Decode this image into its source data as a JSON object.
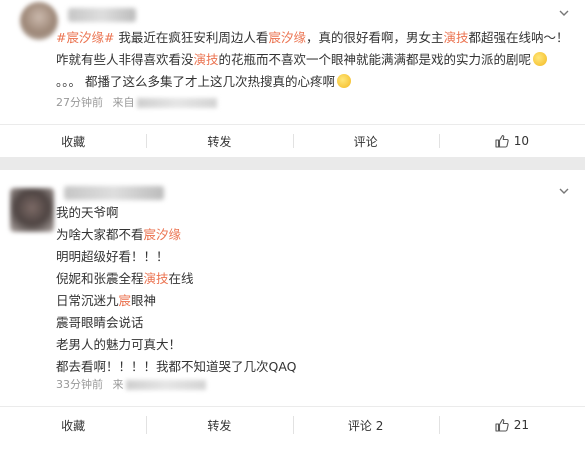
{
  "posts": [
    {
      "lines": [
        [
          {
            "t": "#宸汐缘#",
            "hl": true
          },
          {
            "t": " 我最近在疯狂安利周边人看",
            "hl": false
          },
          {
            "t": "宸汐缘",
            "hl": true
          },
          {
            "t": "，真的很好看啊，男女主",
            "hl": false
          },
          {
            "t": "演技",
            "hl": true
          },
          {
            "t": "都超强在线呐～！",
            "hl": false
          }
        ],
        [
          {
            "t": "咋就有些人非得喜欢看没",
            "hl": false
          },
          {
            "t": "演技",
            "hl": true
          },
          {
            "t": "的花瓶而不喜欢一个眼神就能满满都是戏的实力派的剧呢",
            "hl": false
          }
        ],
        [
          {
            "t": "。。。 都播了这么多集了才上这几次热搜真的心疼啊",
            "hl": false
          }
        ]
      ],
      "emoji_line1": "sweat-emoji",
      "emoji_line2": "cry-emoji",
      "time": "27分钟前",
      "source_prefix": "来自",
      "actions": {
        "favorite": "收藏",
        "forward": "转发",
        "comment": "评论",
        "like_count": "10"
      }
    },
    {
      "lines": [
        [
          {
            "t": "我的天爷啊",
            "hl": false
          }
        ],
        [
          {
            "t": "为啥大家都不看",
            "hl": false
          },
          {
            "t": "宸汐缘",
            "hl": true
          }
        ],
        [
          {
            "t": "明明超级好看！！！",
            "hl": false
          }
        ],
        [
          {
            "t": "倪妮和张震全程",
            "hl": false
          },
          {
            "t": "演技",
            "hl": true
          },
          {
            "t": "在线",
            "hl": false
          }
        ],
        [
          {
            "t": "日常沉迷九",
            "hl": false
          },
          {
            "t": "宸",
            "hl": true
          },
          {
            "t": "眼神",
            "hl": false
          }
        ],
        [
          {
            "t": "震哥眼睛会说话",
            "hl": false
          }
        ],
        [
          {
            "t": "老男人的魅力可真大！",
            "hl": false
          }
        ],
        [
          {
            "t": "都去看啊！！！！我都不知道哭了几次QAQ",
            "hl": false
          }
        ]
      ],
      "time": "33分钟前",
      "source_prefix": "来",
      "actions": {
        "favorite": "收藏",
        "forward": "转发",
        "comment": "评论 2",
        "like_count": "21"
      }
    }
  ],
  "colors": {
    "highlight": "#eb7350",
    "text": "#333333",
    "meta": "#999999",
    "background": "#eaeaea"
  }
}
